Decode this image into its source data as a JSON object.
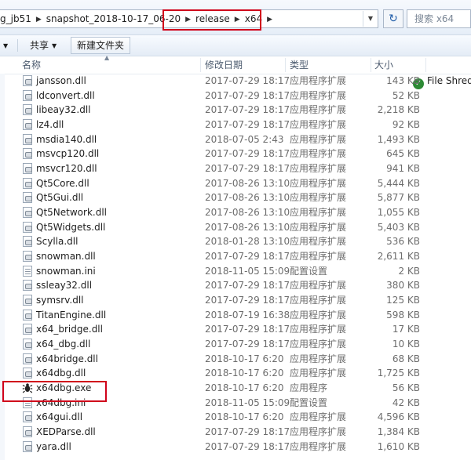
{
  "address": {
    "crumbs": [
      "g_jb51",
      "snapshot_2018-10-17_06-20",
      "release",
      "x64"
    ],
    "search_placeholder": "搜索 x64",
    "refresh_icon": "refresh-icon",
    "dropdown_icon": "chevron-down-icon"
  },
  "toolbar": {
    "share_label": "共享",
    "new_folder_label": "新建文件夹",
    "shredder_label": "File Shredder",
    "shredder_icon": "shredder-icon"
  },
  "columns": {
    "name": "名称",
    "modified": "修改日期",
    "type": "类型",
    "size": "大小"
  },
  "highlight_color": "#d0021b",
  "files": [
    {
      "name": "jansson.dll",
      "date": "2017-07-29 18:17",
      "type": "应用程序扩展",
      "size": "143 KB",
      "icon": "dll"
    },
    {
      "name": "ldconvert.dll",
      "date": "2017-07-29 18:17",
      "type": "应用程序扩展",
      "size": "52 KB",
      "icon": "dll"
    },
    {
      "name": "libeay32.dll",
      "date": "2017-07-29 18:17",
      "type": "应用程序扩展",
      "size": "2,218 KB",
      "icon": "dll"
    },
    {
      "name": "lz4.dll",
      "date": "2017-07-29 18:17",
      "type": "应用程序扩展",
      "size": "92 KB",
      "icon": "dll"
    },
    {
      "name": "msdia140.dll",
      "date": "2018-07-05 2:43",
      "type": "应用程序扩展",
      "size": "1,493 KB",
      "icon": "dll"
    },
    {
      "name": "msvcp120.dll",
      "date": "2017-07-29 18:17",
      "type": "应用程序扩展",
      "size": "645 KB",
      "icon": "dll"
    },
    {
      "name": "msvcr120.dll",
      "date": "2017-07-29 18:17",
      "type": "应用程序扩展",
      "size": "941 KB",
      "icon": "dll"
    },
    {
      "name": "Qt5Core.dll",
      "date": "2017-08-26 13:10",
      "type": "应用程序扩展",
      "size": "5,444 KB",
      "icon": "dll"
    },
    {
      "name": "Qt5Gui.dll",
      "date": "2017-08-26 13:10",
      "type": "应用程序扩展",
      "size": "5,877 KB",
      "icon": "dll"
    },
    {
      "name": "Qt5Network.dll",
      "date": "2017-08-26 13:10",
      "type": "应用程序扩展",
      "size": "1,055 KB",
      "icon": "dll"
    },
    {
      "name": "Qt5Widgets.dll",
      "date": "2017-08-26 13:10",
      "type": "应用程序扩展",
      "size": "5,403 KB",
      "icon": "dll"
    },
    {
      "name": "Scylla.dll",
      "date": "2018-01-28 13:10",
      "type": "应用程序扩展",
      "size": "536 KB",
      "icon": "dll"
    },
    {
      "name": "snowman.dll",
      "date": "2017-07-29 18:17",
      "type": "应用程序扩展",
      "size": "2,611 KB",
      "icon": "dll"
    },
    {
      "name": "snowman.ini",
      "date": "2018-11-05 15:09",
      "type": "配置设置",
      "size": "2 KB",
      "icon": "ini"
    },
    {
      "name": "ssleay32.dll",
      "date": "2017-07-29 18:17",
      "type": "应用程序扩展",
      "size": "380 KB",
      "icon": "dll"
    },
    {
      "name": "symsrv.dll",
      "date": "2017-07-29 18:17",
      "type": "应用程序扩展",
      "size": "125 KB",
      "icon": "dll"
    },
    {
      "name": "TitanEngine.dll",
      "date": "2018-07-19 16:38",
      "type": "应用程序扩展",
      "size": "598 KB",
      "icon": "dll"
    },
    {
      "name": "x64_bridge.dll",
      "date": "2017-07-29 18:17",
      "type": "应用程序扩展",
      "size": "17 KB",
      "icon": "dll"
    },
    {
      "name": "x64_dbg.dll",
      "date": "2017-07-29 18:17",
      "type": "应用程序扩展",
      "size": "10 KB",
      "icon": "dll"
    },
    {
      "name": "x64bridge.dll",
      "date": "2018-10-17 6:20",
      "type": "应用程序扩展",
      "size": "68 KB",
      "icon": "dll"
    },
    {
      "name": "x64dbg.dll",
      "date": "2018-10-17 6:20",
      "type": "应用程序扩展",
      "size": "1,725 KB",
      "icon": "dll"
    },
    {
      "name": "x64dbg.exe",
      "date": "2018-10-17 6:20",
      "type": "应用程序",
      "size": "56 KB",
      "icon": "exe"
    },
    {
      "name": "x64dbg.ini",
      "date": "2018-11-05 15:09",
      "type": "配置设置",
      "size": "42 KB",
      "icon": "ini"
    },
    {
      "name": "x64gui.dll",
      "date": "2018-10-17 6:20",
      "type": "应用程序扩展",
      "size": "4,596 KB",
      "icon": "dll"
    },
    {
      "name": "XEDParse.dll",
      "date": "2017-07-29 18:17",
      "type": "应用程序扩展",
      "size": "1,384 KB",
      "icon": "dll"
    },
    {
      "name": "yara.dll",
      "date": "2017-07-29 18:17",
      "type": "应用程序扩展",
      "size": "1,610 KB",
      "icon": "dll"
    }
  ]
}
